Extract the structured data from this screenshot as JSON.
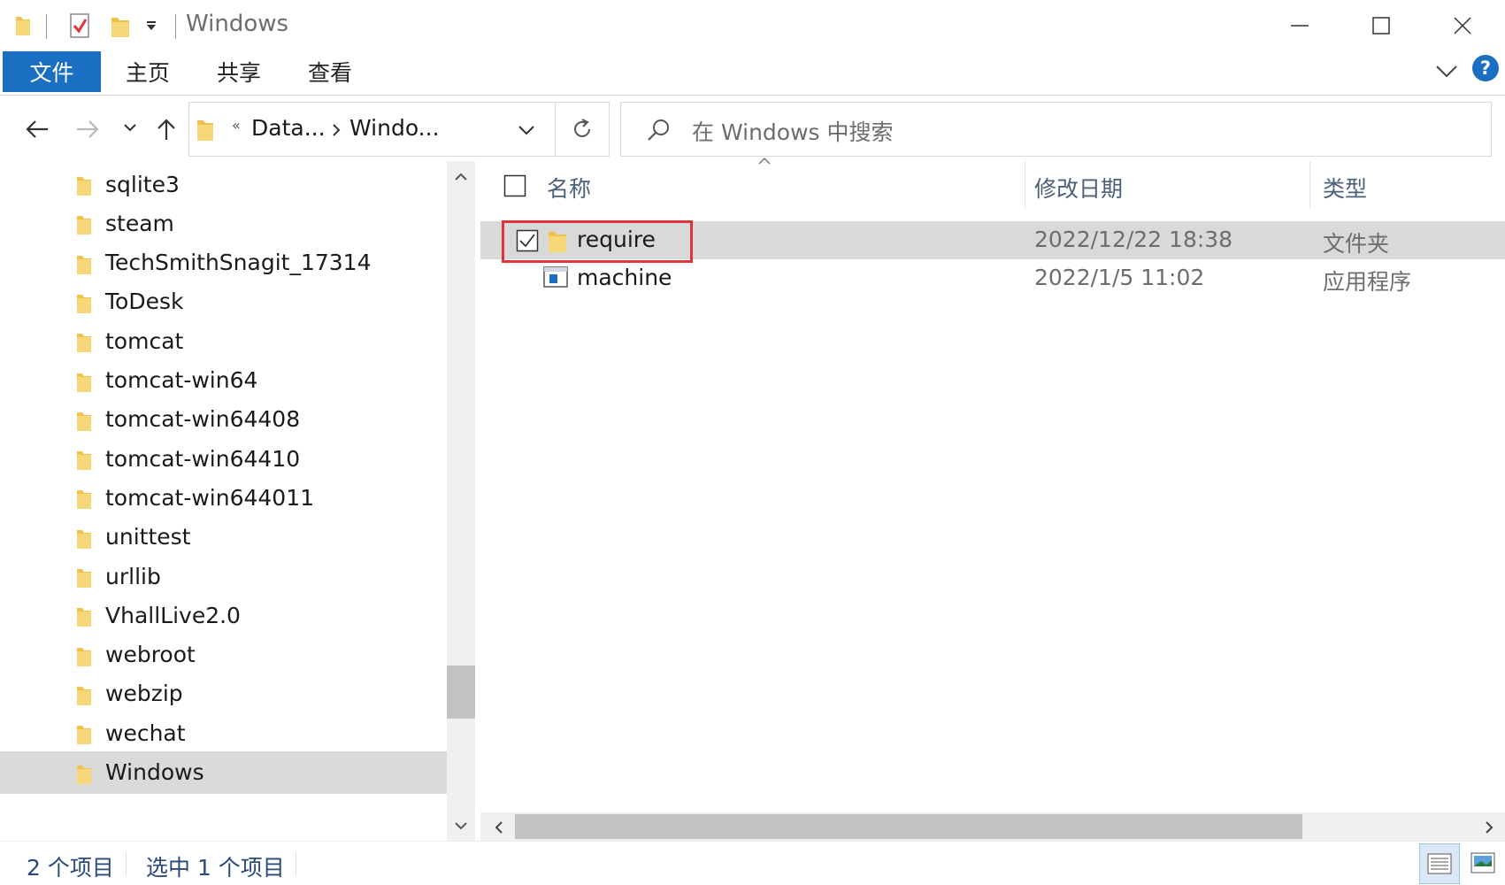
{
  "window": {
    "title": "Windows",
    "minimize_icon": "minimize-icon",
    "maximize_icon": "maximize-icon",
    "close_icon": "close-icon"
  },
  "ribbon": {
    "tabs": [
      "文件",
      "主页",
      "共享",
      "查看"
    ],
    "help_label": "?"
  },
  "address": {
    "overflow": "«",
    "segments": [
      "Data...",
      "Windo..."
    ],
    "search_placeholder": "在 Windows 中搜索"
  },
  "nav_tree": {
    "items": [
      {
        "label": "sqlite3"
      },
      {
        "label": "steam"
      },
      {
        "label": "TechSmithSnagit_17314"
      },
      {
        "label": "ToDesk"
      },
      {
        "label": "tomcat"
      },
      {
        "label": "tomcat-win64"
      },
      {
        "label": "tomcat-win64408"
      },
      {
        "label": "tomcat-win64410"
      },
      {
        "label": "tomcat-win644011"
      },
      {
        "label": "unittest"
      },
      {
        "label": "urllib"
      },
      {
        "label": "VhallLive2.0"
      },
      {
        "label": "webroot"
      },
      {
        "label": "webzip"
      },
      {
        "label": "wechat"
      },
      {
        "label": "Windows"
      }
    ],
    "selected": "Windows"
  },
  "file_list": {
    "columns": [
      "名称",
      "修改日期",
      "类型"
    ],
    "rows": [
      {
        "name": "require",
        "modified": "2022/12/22 18:38",
        "type": "文件夹",
        "icon": "folder-icon",
        "selected": true
      },
      {
        "name": "machine",
        "modified": "2022/1/5 11:02",
        "type": "应用程序",
        "icon": "application-icon",
        "selected": false
      }
    ]
  },
  "status": {
    "item_count": "2 个项目",
    "selection": "选中 1 个项目"
  },
  "colors": {
    "accent": "#1a6fc2",
    "selection_bg": "#d9d9d9",
    "highlight_border": "#e0343b",
    "folder": "#f3c550"
  }
}
